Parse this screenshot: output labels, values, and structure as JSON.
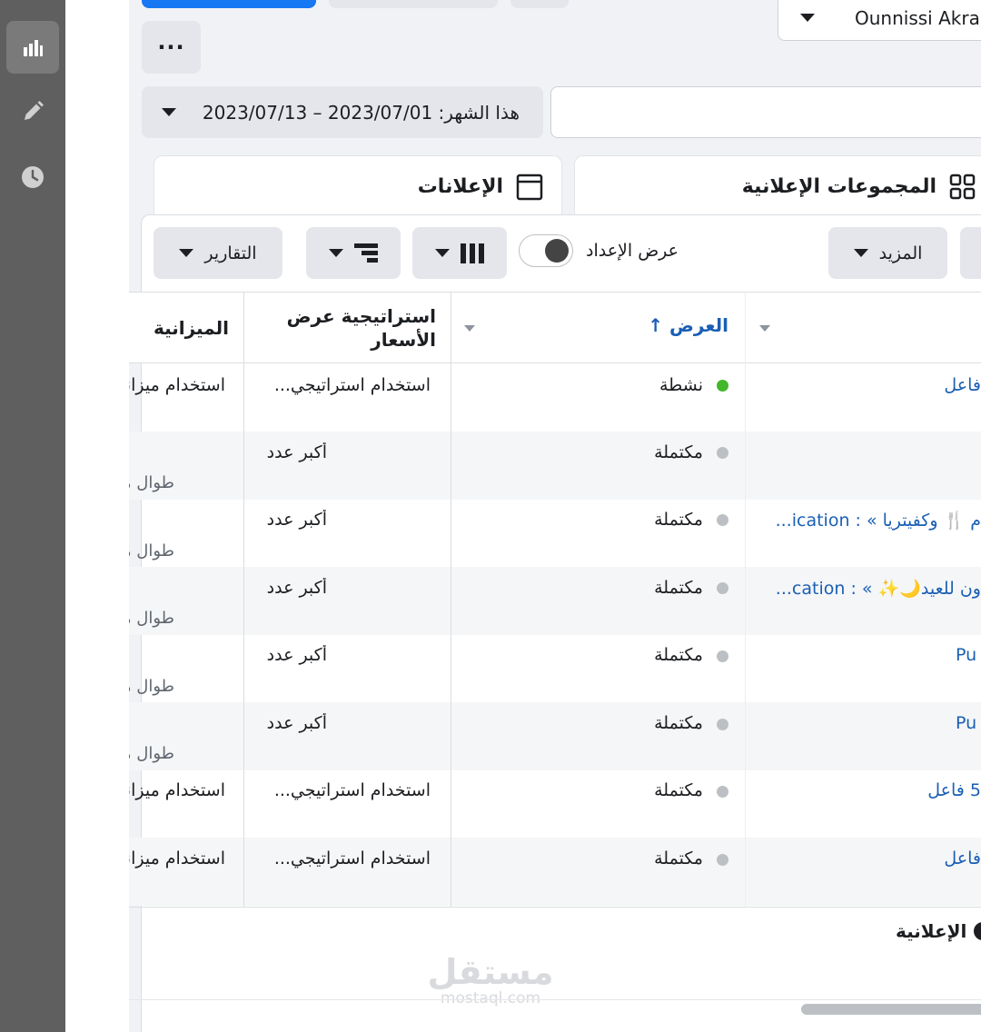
{
  "account": {
    "name": "Ounnissi Akram"
  },
  "toolbar_top": {
    "more_label": "···"
  },
  "date_range": {
    "label": "هذا الشهر: 2023/07/01 – 2023/07/13"
  },
  "tabs": [
    {
      "label": "المجموعات الإعلانية",
      "icon": "grid-icon"
    },
    {
      "label": "الإعلانات",
      "icon": "ad-frame-icon"
    }
  ],
  "toolbar": {
    "more_label": "المزيد",
    "setup_view_label": "عرض الإعداد",
    "reports_label": "التقارير"
  },
  "table": {
    "headers": {
      "delivery": "العرض ↑",
      "bid_strategy": "استراتيجية عرض الأسعار",
      "budget": "الميزانية"
    },
    "rows": [
      {
        "name": "فاعل",
        "status": "نشطة",
        "status_color": "#42b72a",
        "bid": "استخدام استراتيجي...",
        "bid_sub": "",
        "budget": "استخدام ميزانية",
        "budget_sub": ""
      },
      {
        "name": "",
        "status": "مكتملة",
        "status_color": "#bcc0c4",
        "bid": "أكبر عدد",
        "bid_sub": "",
        "budget": "",
        "budget_sub": "طوال مدة"
      },
      {
        "name": "م 🍴 وكفيتريا » : ication...",
        "status": "مكتملة",
        "status_color": "#bcc0c4",
        "bid": "أكبر عدد",
        "bid_sub": "",
        "budget": "",
        "budget_sub": "طوال مدة"
      },
      {
        "name": "ون للعيد🌙✨ » : cation...",
        "status": "مكتملة",
        "status_color": "#bcc0c4",
        "bid": "أكبر عدد",
        "bid_sub": "",
        "budget": "",
        "budget_sub": "طوال مدة"
      },
      {
        "name": "Pu",
        "status": "مكتملة",
        "status_color": "#bcc0c4",
        "bid": "أكبر عدد",
        "bid_sub": "",
        "budget": "",
        "budget_sub": "طوال مدة"
      },
      {
        "name": "Pu",
        "status": "مكتملة",
        "status_color": "#bcc0c4",
        "bid": "أكبر عدد",
        "bid_sub": "",
        "budget": "",
        "budget_sub": "طوال مدة"
      },
      {
        "name": "5 فاعل",
        "status": "مكتملة",
        "status_color": "#bcc0c4",
        "bid": "استخدام استراتيجي...",
        "bid_sub": "",
        "budget": "استخدام ميزانية",
        "budget_sub": ""
      },
      {
        "name": "فاعل",
        "status": "مكتملة",
        "status_color": "#bcc0c4",
        "bid": "استخدام استراتيجي...",
        "bid_sub": "",
        "budget": "استخدام ميزانية",
        "budget_sub": ""
      }
    ]
  },
  "footer": {
    "label": "الإعلانية",
    "info_icon": "info-icon"
  },
  "watermark": {
    "ar": "مستقل",
    "en": "mostaql.com"
  },
  "colors": {
    "accent": "#1877f2",
    "link": "#1a5fb4",
    "active": "#42b72a",
    "inactive": "#bcc0c4"
  }
}
